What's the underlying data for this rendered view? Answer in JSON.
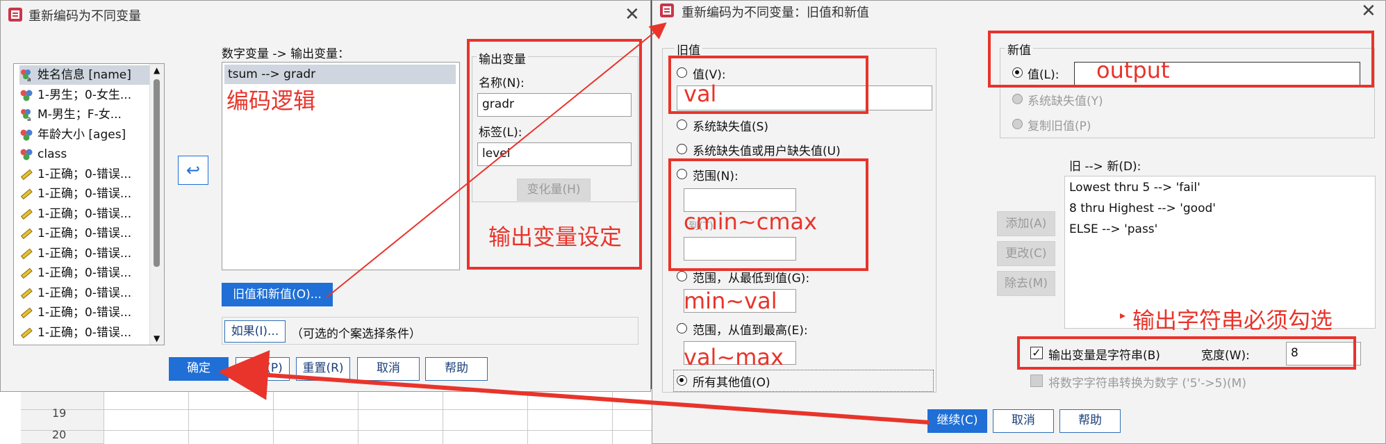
{
  "background_grid": {
    "rows": [
      "19",
      "20"
    ]
  },
  "left_dialog": {
    "title": "重新编码为不同变量",
    "variables": [
      {
        "label": "姓名信息 [name]",
        "icon": "nominal-string-icon"
      },
      {
        "label": "1-男生；0-女生...",
        "icon": "nominal-icon"
      },
      {
        "label": "M-男生；F-女...",
        "icon": "nominal-string-icon"
      },
      {
        "label": "年龄大小 [ages]",
        "icon": "nominal-icon"
      },
      {
        "label": "class",
        "icon": "nominal-icon"
      },
      {
        "label": "1-正确；0-错误...",
        "icon": "scale-icon"
      },
      {
        "label": "1-正确；0-错误...",
        "icon": "scale-icon"
      },
      {
        "label": "1-正确；0-错误...",
        "icon": "scale-icon"
      },
      {
        "label": "1-正确；0-错误...",
        "icon": "scale-icon"
      },
      {
        "label": "1-正确；0-错误...",
        "icon": "scale-icon"
      },
      {
        "label": "1-正确；0-错误...",
        "icon": "scale-icon"
      },
      {
        "label": "1-正确；0-错误...",
        "icon": "scale-icon"
      },
      {
        "label": "1-正确；0-错误...",
        "icon": "scale-icon"
      },
      {
        "label": "1-正确；0-错误...",
        "icon": "scale-icon"
      }
    ],
    "numeric_to_output_label": "数字变量 -> 输出变量：",
    "mapping": "tsum --> gradr",
    "output_group_title": "输出变量",
    "name_label": "名称(N):",
    "name_value": "gradr",
    "label_label": "标签(L):",
    "label_value": "level",
    "change_button": "变化量(H)",
    "old_new_button": "旧值和新值(O)...",
    "if_button": "如果(I)...",
    "if_hint": "（可选的个案选择条件）",
    "buttons": {
      "ok": "确定",
      "paste": "粘贴(P)",
      "reset": "重置(R)",
      "cancel": "取消",
      "help": "帮助"
    }
  },
  "right_dialog": {
    "title": "重新编码为不同变量：旧值和新值",
    "old_group_title": "旧值",
    "old_options": {
      "value": "值(V):",
      "sysmis": "系统缺失值(S)",
      "sys_or_user_mis": "系统缺失值或用户缺失值(U)",
      "range": "范围(N):",
      "through_hidden": "到(T)",
      "range_lowest": "范围，从最低到值(G):",
      "range_highest": "范围，从值到最高(E):",
      "all_other": "所有其他值(O)"
    },
    "new_group_title": "新值",
    "new_options": {
      "value": "值(L):",
      "sysmis": "系统缺失值(Y)",
      "copy_old": "复制旧值(P)"
    },
    "old_new_list_label": "旧 --> 新(D):",
    "old_new_list": [
      "Lowest thru 5 --> 'fail'",
      "8 thru Highest --> 'good'",
      "ELSE --> 'pass'"
    ],
    "add_button": "添加(A)",
    "change_button": "更改(C)",
    "remove_button": "除去(M)",
    "string_output_label": "输出变量是字符串(B)",
    "width_label": "宽度(W):",
    "width_value": "8",
    "convert_label": "将数字字符串转换为数字 ('5'->5)(M)",
    "buttons": {
      "continue": "继续(C)",
      "cancel": "取消",
      "help": "帮助"
    }
  },
  "annotations": {
    "encoding_logic": "编码逻辑",
    "output_setting": "输出变量设定",
    "val": "val",
    "range": "cmin~cmax",
    "min_val": "min~val",
    "val_max": "val~max",
    "output": "output",
    "must_check": "输出字符串必须勾选",
    "color": "#e8342b"
  }
}
